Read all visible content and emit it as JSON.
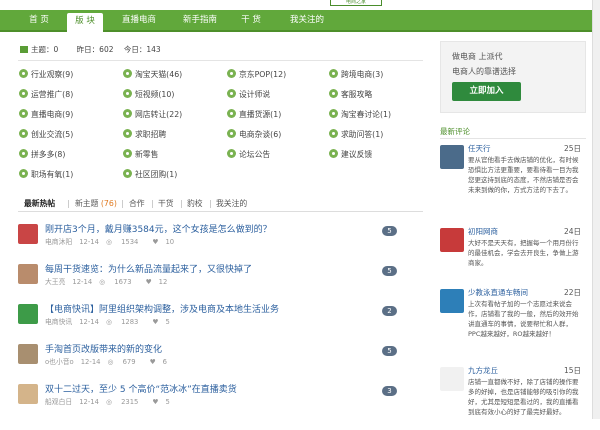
{
  "header": {
    "logo_text": "电商之家"
  },
  "nav": {
    "items": [
      {
        "label": "首 页"
      },
      {
        "label": "版 块"
      },
      {
        "label": "直播电商"
      },
      {
        "label": "新手指南"
      },
      {
        "label": "干 货"
      },
      {
        "label": "我关注的"
      }
    ],
    "active_index": 1
  },
  "stats": {
    "topics": "主题：0",
    "yesterday": "昨日：602",
    "today": "今日：143"
  },
  "forums": [
    {
      "label": "行业观察(9)"
    },
    {
      "label": "淘宝天猫(46)"
    },
    {
      "label": "京东POP(12)"
    },
    {
      "label": "跨境电商(3)"
    },
    {
      "label": "运营推广(8)"
    },
    {
      "label": "短视频(10)"
    },
    {
      "label": "设计师说"
    },
    {
      "label": "客服攻略"
    },
    {
      "label": "直播电商(9)"
    },
    {
      "label": "网店转让(22)"
    },
    {
      "label": "直播货源(1)"
    },
    {
      "label": "淘宝春讨论(1)"
    },
    {
      "label": "创业交流(5)"
    },
    {
      "label": "求职招聘"
    },
    {
      "label": "电商杂谈(6)"
    },
    {
      "label": "求助问答(1)"
    },
    {
      "label": "拼多多(8)"
    },
    {
      "label": "新零售"
    },
    {
      "label": "论坛公告"
    },
    {
      "label": "建议反馈"
    },
    {
      "label": "职场有氧(1)"
    },
    {
      "label": "社区团购(1)"
    }
  ],
  "tabs": [
    {
      "label": "最新热帖"
    },
    {
      "label": "新主题",
      "count": "(76)"
    },
    {
      "label": "合作"
    },
    {
      "label": "干货"
    },
    {
      "label": "豹校"
    },
    {
      "label": "我关注的"
    }
  ],
  "threads": [
    {
      "title": "刚开店3个月，戴月赚3584元，这个女孩是怎么做到的？",
      "author": "电商沐阳",
      "date": "12-14",
      "views": "1534",
      "likes": "10",
      "replies": "5",
      "avatar_color": "#c94545"
    },
    {
      "title": "每周干货速览：为什么新品流量起来了，又很快掉了",
      "author": "大王亮",
      "date": "12-14",
      "views": "1673",
      "likes": "12",
      "replies": "5",
      "avatar_color": "#b98c6c"
    },
    {
      "title": "【电商快讯】阿里组织架构调整，涉及电商及本地生活业务",
      "author": "电商快讯",
      "date": "12-14",
      "views": "1283",
      "likes": "5",
      "replies": "2",
      "avatar_color": "#3d9b48"
    },
    {
      "title": "手淘首页改版带来的新的变化",
      "author": "o也小音o",
      "date": "12-14",
      "views": "679",
      "likes": "6",
      "replies": "5",
      "avatar_color": "#a88f70"
    },
    {
      "title": "双十二过天，至少 5 个高价“范冰冰”在直播卖货",
      "author": "船观白日",
      "date": "12-14",
      "views": "2315",
      "likes": "5",
      "replies": "3",
      "avatar_color": "#d4b48a"
    }
  ],
  "promo": {
    "line1": "做电商 上派代",
    "line2": "电商人的靠谱选择",
    "button": "立即加入"
  },
  "sidebar": {
    "title": "最新评论",
    "comments": [
      {
        "name": "任天行",
        "date": "25日",
        "text": "要从官他看手去做店铺的优化，有时候恐惧比方法更重要，要看待看一目为我您更这持到底的态度，不然店铺是否会未来到做的你，方式方法的下去了。",
        "avatar_color": "#4b6b8a"
      },
      {
        "name": "初阳网商",
        "date": "24日",
        "text": "大好不是天天有，把握每一个用月份行的最佳机会，学会去开良生，争做上游商家。",
        "avatar_color": "#c73a3a"
      },
      {
        "name": "少教泳直通车畅间",
        "date": "22日",
        "text": "上次有看帖子加的一个志愿过来说会作，店铺看了我的一般，然后的效开始讲直通车的事情，说要帮忙和人群，PPC越来越好，RO越来越好！",
        "avatar_color": "#2d7fb8"
      },
      {
        "name": "九方龙丘",
        "date": "15日",
        "text": "店铺一直都做不好，除了店铺的操作要多的好掉，也是店铺能够的吸引你的我好，尤其是短短是看过的，我的直播看到底有效小心的好了最完好最好。",
        "avatar_color": "#f1f1f1"
      }
    ]
  }
}
